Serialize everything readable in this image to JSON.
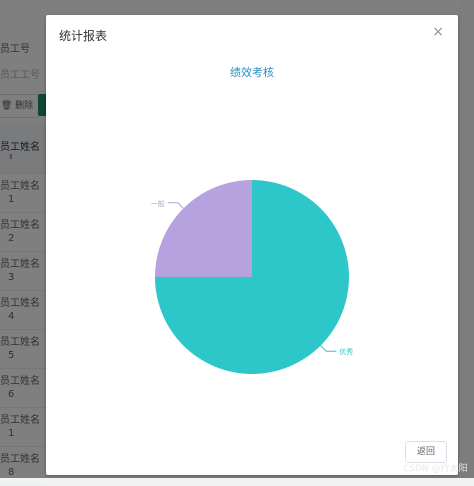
{
  "background": {
    "field1_label": "员工号",
    "field2_placeholder": "员工工号",
    "delete_label": "删除",
    "table_header": "员工姓名",
    "rows": [
      {
        "name": "员工姓名",
        "num": "1"
      },
      {
        "name": "员工姓名",
        "num": "2"
      },
      {
        "name": "员工姓名",
        "num": "3"
      },
      {
        "name": "员工姓名",
        "num": "4"
      },
      {
        "name": "员工姓名",
        "num": "5"
      },
      {
        "name": "员工姓名",
        "num": "6"
      },
      {
        "name": "员工姓名",
        "num": "1"
      },
      {
        "name": "员工姓名",
        "num": "8"
      }
    ]
  },
  "dialog": {
    "title": "统计报表",
    "close_icon": "close-icon",
    "return_label": "返回"
  },
  "chart_data": {
    "type": "pie",
    "title": "绩效考核",
    "slices": [
      {
        "label": "优秀",
        "value": 75,
        "color": "#2ec7c9"
      },
      {
        "label": "一般",
        "value": 25,
        "color": "#b6a2de"
      }
    ]
  },
  "watermark": "CSDN @行太阳"
}
